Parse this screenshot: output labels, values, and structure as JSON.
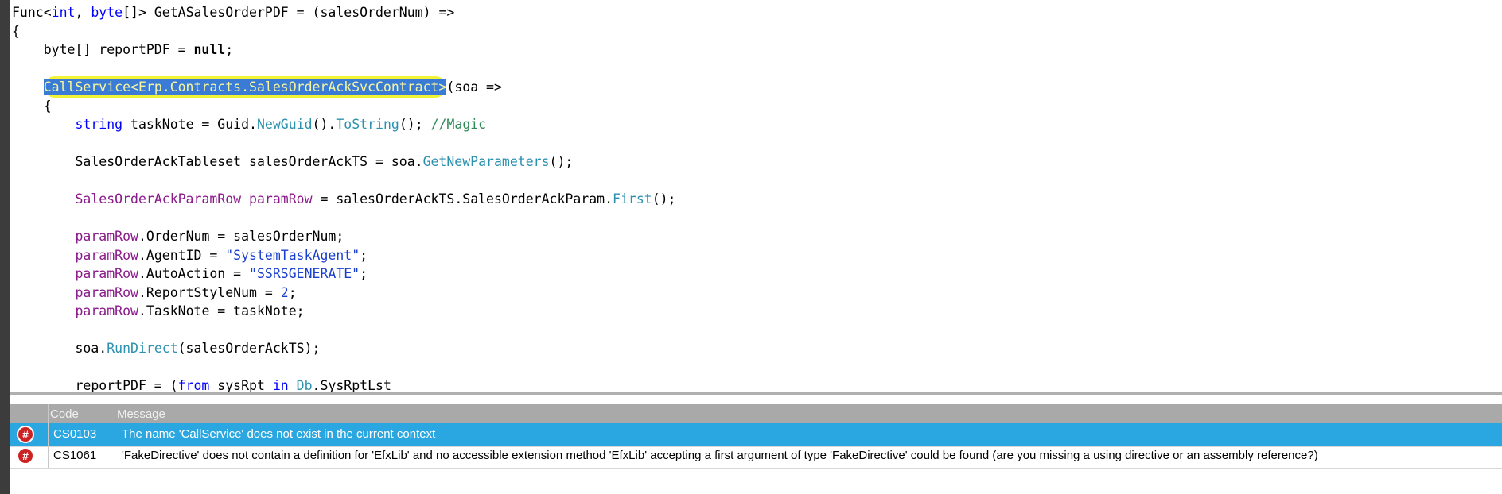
{
  "code_lines": [
    {
      "tokens": [
        [
          "",
          "Func<"
        ],
        [
          "kw",
          "int"
        ],
        [
          "",
          ", "
        ],
        [
          "kw",
          "byte"
        ],
        [
          "",
          "[]> GetASalesOrderPDF = (salesOrderNum) =>"
        ]
      ]
    },
    {
      "tokens": [
        [
          "",
          "{"
        ]
      ]
    },
    {
      "tokens": [
        [
          "",
          "    byte[] reportPDF = "
        ],
        [
          "bo",
          "null"
        ],
        [
          "",
          ";"
        ]
      ]
    },
    {
      "tokens": [
        [
          "",
          ""
        ]
      ]
    },
    {
      "tokens": [
        [
          "",
          "    "
        ],
        [
          "sel",
          "CallService<Erp.Contracts.SalesOrderAckSvcContract>"
        ],
        [
          "",
          "(soa =>"
        ]
      ]
    },
    {
      "tokens": [
        [
          "",
          "    {"
        ]
      ]
    },
    {
      "tokens": [
        [
          "",
          "        "
        ],
        [
          "kw",
          "string"
        ],
        [
          "",
          " taskNote = Guid."
        ],
        [
          "me",
          "NewGuid"
        ],
        [
          "",
          "()."
        ],
        [
          "me",
          "ToString"
        ],
        [
          "",
          "(); "
        ],
        [
          "cm",
          "//Magic"
        ]
      ]
    },
    {
      "tokens": [
        [
          "",
          ""
        ]
      ]
    },
    {
      "tokens": [
        [
          "",
          "        SalesOrderAckTableset salesOrderAckTS = soa."
        ],
        [
          "me",
          "GetNewParameters"
        ],
        [
          "",
          "();"
        ]
      ]
    },
    {
      "tokens": [
        [
          "",
          ""
        ]
      ]
    },
    {
      "tokens": [
        [
          "",
          "        "
        ],
        [
          "ty",
          "SalesOrderAckParamRow"
        ],
        [
          "",
          ""
        ],
        [
          "ty",
          " paramRow"
        ],
        [
          "",
          " = salesOrderAckTS.SalesOrderAckParam."
        ],
        [
          "me",
          "First"
        ],
        [
          "",
          "();"
        ]
      ]
    },
    {
      "tokens": [
        [
          "",
          ""
        ]
      ]
    },
    {
      "tokens": [
        [
          "",
          "        "
        ],
        [
          "ty",
          "paramRow"
        ],
        [
          "",
          ".OrderNum = salesOrderNum;"
        ]
      ]
    },
    {
      "tokens": [
        [
          "",
          "        "
        ],
        [
          "ty",
          "paramRow"
        ],
        [
          "",
          ".AgentID = "
        ],
        [
          "st",
          "\"SystemTaskAgent\""
        ],
        [
          "",
          ";"
        ]
      ]
    },
    {
      "tokens": [
        [
          "",
          "        "
        ],
        [
          "ty",
          "paramRow"
        ],
        [
          "",
          ".AutoAction = "
        ],
        [
          "st",
          "\"SSRSGENERATE\""
        ],
        [
          "",
          ";"
        ]
      ]
    },
    {
      "tokens": [
        [
          "",
          "        "
        ],
        [
          "ty",
          "paramRow"
        ],
        [
          "",
          ".ReportStyleNum = "
        ],
        [
          "st",
          "2"
        ],
        [
          "",
          ";"
        ]
      ]
    },
    {
      "tokens": [
        [
          "",
          "        "
        ],
        [
          "ty",
          "paramRow"
        ],
        [
          "",
          ".TaskNote = taskNote;"
        ]
      ]
    },
    {
      "tokens": [
        [
          "",
          ""
        ]
      ]
    },
    {
      "tokens": [
        [
          "",
          "        soa."
        ],
        [
          "me",
          "RunDirect"
        ],
        [
          "",
          "(salesOrderAckTS);"
        ]
      ]
    },
    {
      "tokens": [
        [
          "",
          ""
        ]
      ]
    },
    {
      "tokens": [
        [
          "",
          "        reportPDF = ("
        ],
        [
          "kw",
          "from"
        ],
        [
          "",
          " sysRpt "
        ],
        [
          "kw",
          "in"
        ],
        [
          "",
          " "
        ],
        [
          "me",
          "Db"
        ],
        [
          "",
          ".SysRptLst"
        ]
      ]
    }
  ],
  "error_panel": {
    "headers": {
      "code": "Code",
      "message": "Message"
    },
    "rows": [
      {
        "icon": "error-icon",
        "glyph": "#",
        "code": "CS0103",
        "message": "The name 'CallService' does not exist in the current context",
        "selected": true
      },
      {
        "icon": "error-icon",
        "glyph": "#",
        "code": "CS1061",
        "message": "'FakeDirective' does not contain a definition for 'EfxLib' and no accessible extension method 'EfxLib' accepting a first argument of type 'FakeDirective' could be found (are you missing a using directive or an assembly reference?)",
        "selected": false
      }
    ]
  },
  "colors": {
    "selection": "#3a7bd5",
    "highlight": "#f3f336",
    "error_row_selected": "#2aa7e0",
    "error_icon": "#cc2222"
  }
}
